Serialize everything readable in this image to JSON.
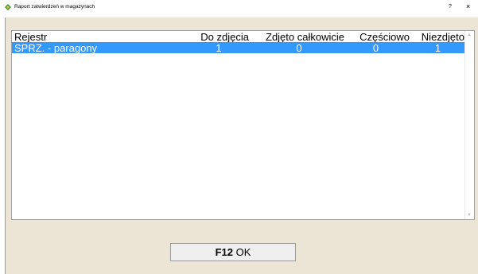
{
  "window": {
    "title": "Raport zatwierdzeń w magazynach",
    "help_label": "?",
    "close_label": "×"
  },
  "table": {
    "columns": [
      "Rejestr",
      "Do zdjęcia",
      "Zdjęto całkowicie",
      "Częściowo",
      "Niezdjęto"
    ],
    "rows": [
      {
        "rejestr": "SPRZ. - paragony",
        "do_zdjecia": "1",
        "zdjeto_calkowicie": "0",
        "czesciowo": "0",
        "niezdjeto": "1",
        "selected": true
      }
    ]
  },
  "scrollbar": {
    "up_icon": "▲",
    "down_icon": "▼"
  },
  "ok_button": {
    "key": "F12",
    "label": "OK"
  },
  "colors": {
    "selection": "#3399ff",
    "client_background": "#ece4d4"
  }
}
